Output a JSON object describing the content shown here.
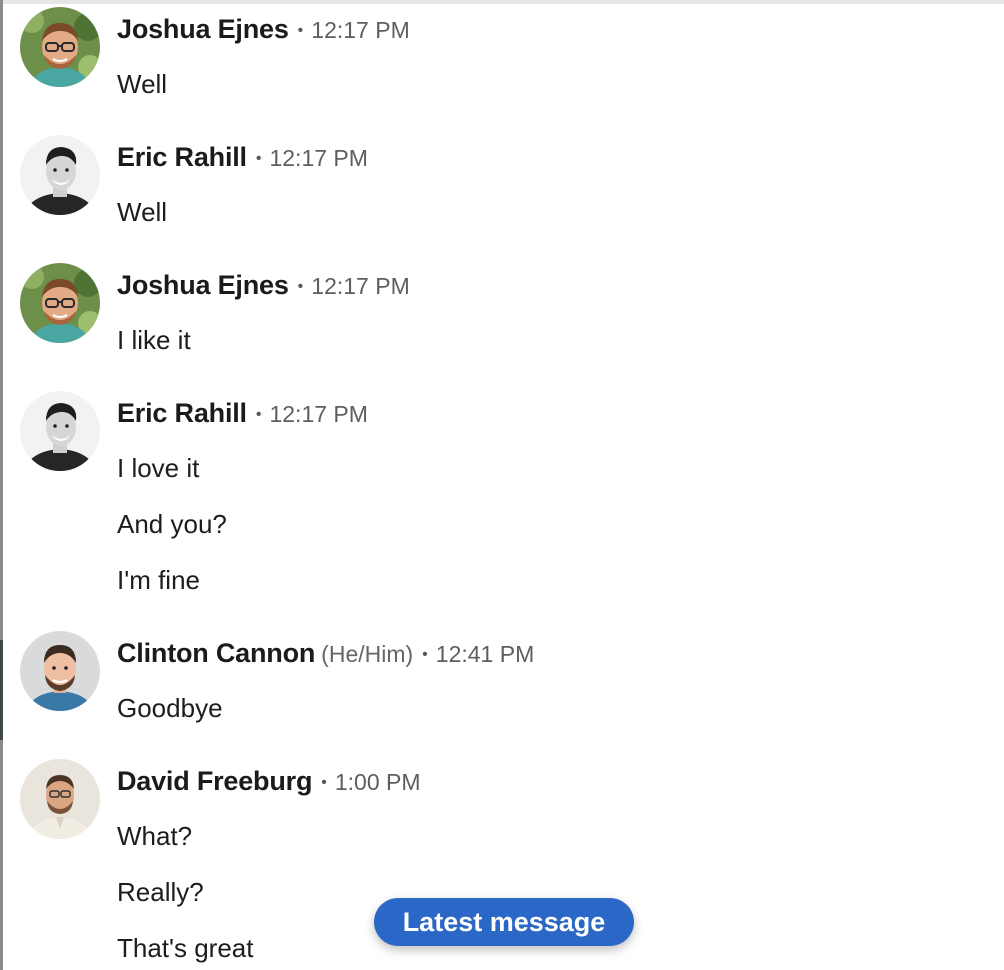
{
  "messages": [
    {
      "sender": "Joshua Ejnes",
      "pronouns": "",
      "time": "12:17 PM",
      "avatar_icon": "joshua-ejnes-avatar",
      "lines": [
        "Well"
      ]
    },
    {
      "sender": "Eric Rahill",
      "pronouns": "",
      "time": "12:17 PM",
      "avatar_icon": "eric-rahill-avatar",
      "lines": [
        "Well"
      ]
    },
    {
      "sender": "Joshua Ejnes",
      "pronouns": "",
      "time": "12:17 PM",
      "avatar_icon": "joshua-ejnes-avatar",
      "lines": [
        "I like it"
      ]
    },
    {
      "sender": "Eric Rahill",
      "pronouns": "",
      "time": "12:17 PM",
      "avatar_icon": "eric-rahill-avatar",
      "lines": [
        "I love it",
        "And you?",
        "I'm fine"
      ]
    },
    {
      "sender": "Clinton Cannon",
      "pronouns": "(He/Him)",
      "time": "12:41 PM",
      "avatar_icon": "clinton-cannon-avatar",
      "lines": [
        "Goodbye"
      ]
    },
    {
      "sender": "David Freeburg",
      "pronouns": "",
      "time": "1:00 PM",
      "avatar_icon": "david-freeburg-avatar",
      "lines": [
        "What?",
        "Really?",
        "That's great"
      ]
    }
  ],
  "separator": "•",
  "latest_button_label": "Latest message",
  "colors": {
    "accent": "#2b67c7",
    "sender_text": "#1b1b1b",
    "meta_text": "#5e5e5e"
  }
}
